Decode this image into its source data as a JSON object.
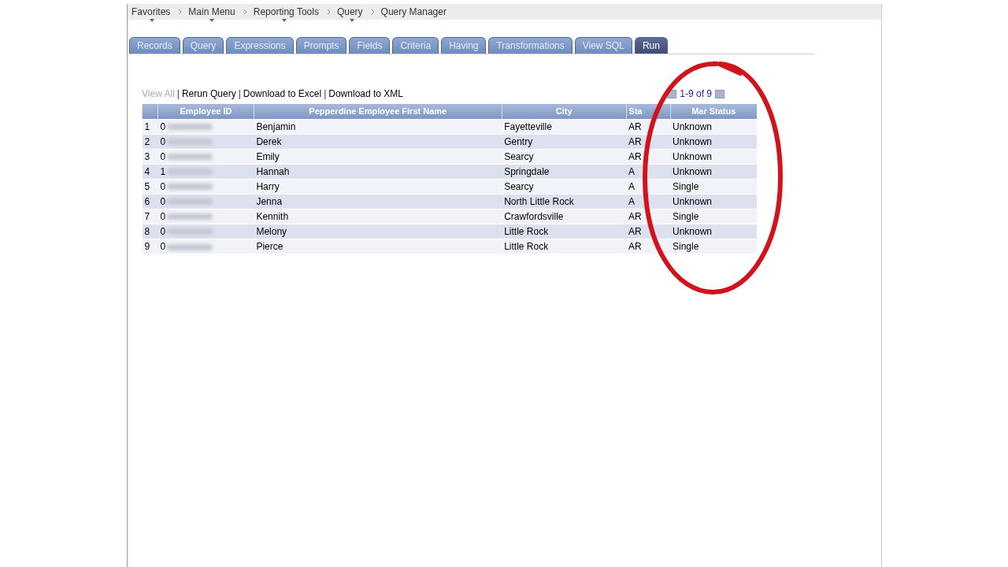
{
  "breadcrumbs": [
    {
      "label": "Favorites",
      "menu": true
    },
    {
      "label": "Main Menu",
      "menu": true
    },
    {
      "label": "Reporting Tools",
      "menu": true
    },
    {
      "label": "Query",
      "menu": true
    },
    {
      "label": "Query Manager",
      "menu": false
    }
  ],
  "tabs": [
    {
      "label": "Records",
      "selected": false
    },
    {
      "label": "Query",
      "selected": false
    },
    {
      "label": "Expressions",
      "selected": false
    },
    {
      "label": "Prompts",
      "selected": false
    },
    {
      "label": "Fields",
      "selected": false
    },
    {
      "label": "Criteria",
      "selected": false
    },
    {
      "label": "Having",
      "selected": false
    },
    {
      "label": "Transformations",
      "selected": false
    },
    {
      "label": "View SQL",
      "selected": false
    },
    {
      "label": "Run",
      "selected": true
    }
  ],
  "actions": [
    {
      "label": "View All",
      "disabled": true
    },
    {
      "label": "Rerun Query",
      "disabled": false
    },
    {
      "label": "Download to Excel",
      "disabled": false
    },
    {
      "label": "Download to XML",
      "disabled": false
    }
  ],
  "action_separator": "|",
  "pager": {
    "range": "1-9 of 9"
  },
  "table": {
    "columns": [
      "Employee ID",
      "Pepperdine Employee First Name",
      "City",
      "Sta",
      "Mar Status"
    ],
    "rows": [
      {
        "num": "1",
        "id": "0",
        "name": "Benjamin",
        "city": "Fayetteville",
        "state": "AR",
        "mar": "Unknown"
      },
      {
        "num": "2",
        "id": "0",
        "name": "Derek",
        "city": "Gentry",
        "state": "AR",
        "mar": "Unknown"
      },
      {
        "num": "3",
        "id": "0",
        "name": "Emily",
        "city": "Searcy",
        "state": "AR",
        "mar": "Unknown"
      },
      {
        "num": "4",
        "id": "1",
        "name": "Hannah",
        "city": "Springdale",
        "state": "A",
        "mar": "Unknown"
      },
      {
        "num": "5",
        "id": "0",
        "name": "Harry",
        "city": "Searcy",
        "state": "A",
        "mar": "Single"
      },
      {
        "num": "6",
        "id": "0",
        "name": "Jenna",
        "city": "North Little Rock",
        "state": "A",
        "mar": "Unknown"
      },
      {
        "num": "7",
        "id": "0",
        "name": "Kennith",
        "city": "Crawfordsville",
        "state": "AR",
        "mar": "Single"
      },
      {
        "num": "8",
        "id": "0",
        "name": "Melony",
        "city": "Little Rock",
        "state": "AR",
        "mar": "Unknown"
      },
      {
        "num": "9",
        "id": "0",
        "name": "Pierce",
        "city": "Little Rock",
        "state": "AR",
        "mar": "Single"
      }
    ]
  }
}
